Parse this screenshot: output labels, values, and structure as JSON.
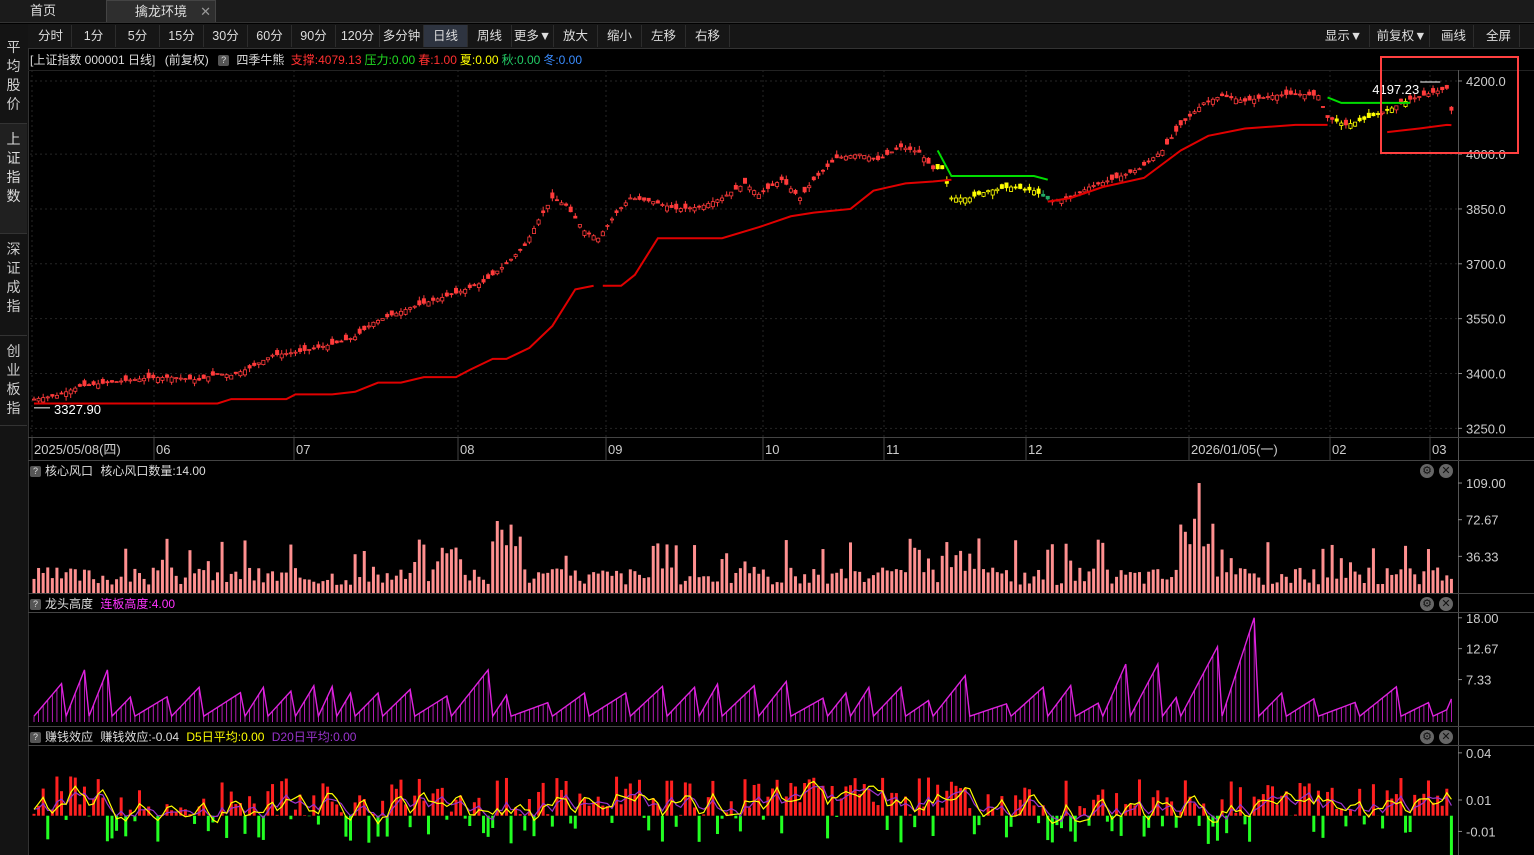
{
  "tabs": {
    "home": "首页",
    "active": "擒龙环境",
    "close": "✕"
  },
  "toolbar": {
    "periods": [
      "分时",
      "1分",
      "5分",
      "15分",
      "30分",
      "60分",
      "90分",
      "120分",
      "多分钟",
      "日线",
      "周线",
      "更多▼",
      "放大",
      "缩小",
      "左移",
      "右移"
    ],
    "active_period": "日线",
    "right": [
      "显示▼",
      "前复权▼",
      "画线",
      "全屏"
    ]
  },
  "sidebar": {
    "items": [
      "平均股价",
      "上证指数",
      "深证成指",
      "创业板指"
    ],
    "active": "上证指数"
  },
  "main": {
    "title": "[上证指数 000001 日线]",
    "adjust": "(前复权)",
    "indicator": "四季牛熊",
    "fields": [
      {
        "label": "支撑:4079.13",
        "color": "#ff3030"
      },
      {
        "label": "压力:0.00",
        "color": "#22dd22"
      },
      {
        "label": "春:1.00",
        "color": "#ff3030"
      },
      {
        "label": "夏:0.00",
        "color": "#ffff00"
      },
      {
        "label": "秋:0.00",
        "color": "#22cc66"
      },
      {
        "label": "冬:0.00",
        "color": "#3a8cff"
      }
    ],
    "high_label": "4197.23",
    "low_label": "3327.90"
  },
  "panels": {
    "p1": {
      "title": "核心风口",
      "field": "核心风口数量:14.00",
      "field_color": "#dddddd"
    },
    "p2": {
      "title": "龙头高度",
      "field": "连板高度:4.00",
      "field_color": "#ff33ff"
    },
    "p3": {
      "title": "赚钱效应",
      "field": "赚钱效应:-0.04",
      "field_color": "#dddddd",
      "d5": "D5日平均:0.00",
      "d5_color": "#ffff00",
      "d20": "D20日平均:0.00",
      "d20_color": "#9933cc"
    }
  },
  "colors": {
    "up": "#ff3b3b",
    "down": "#22c7c7",
    "support": "#e00000",
    "pressure": "#00dd00",
    "summer": "#ffff00",
    "autumn": "#22aa66",
    "bar": "#ff9090",
    "magenta": "#dd22dd",
    "highlight_box": "#ff4040"
  },
  "chart_data": [
    {
      "type": "candlestick",
      "title": "上证指数 000001 日线",
      "y_ticks": [
        4200.0,
        4000.0,
        3850.0,
        3700.0,
        3550.0,
        3400.0,
        3250.0
      ],
      "ylim": [
        3240,
        4230
      ],
      "x_ticks": [
        "2025/05/08(四)",
        "06",
        "07",
        "08",
        "09",
        "10",
        "11",
        "12",
        "2026/01/05(一)",
        "02",
        "03"
      ],
      "close_path": [
        [
          0,
          3330
        ],
        [
          5,
          3340
        ],
        [
          10,
          3365
        ],
        [
          18,
          3378
        ],
        [
          25,
          3388
        ],
        [
          30,
          3390
        ],
        [
          36,
          3382
        ],
        [
          40,
          3400
        ],
        [
          43,
          3395
        ],
        [
          47,
          3415
        ],
        [
          52,
          3450
        ],
        [
          58,
          3460
        ],
        [
          65,
          3480
        ],
        [
          70,
          3500
        ],
        [
          74,
          3540
        ],
        [
          78,
          3560
        ],
        [
          82,
          3580
        ],
        [
          87,
          3600
        ],
        [
          92,
          3620
        ],
        [
          98,
          3650
        ],
        [
          103,
          3700
        ],
        [
          107,
          3750
        ],
        [
          110,
          3820
        ],
        [
          113,
          3880
        ],
        [
          116,
          3860
        ],
        [
          120,
          3790
        ],
        [
          123,
          3770
        ],
        [
          127,
          3840
        ],
        [
          130,
          3880
        ],
        [
          135,
          3870
        ],
        [
          140,
          3850
        ],
        [
          145,
          3855
        ],
        [
          150,
          3880
        ],
        [
          155,
          3920
        ],
        [
          158,
          3890
        ],
        [
          163,
          3930
        ],
        [
          167,
          3880
        ],
        [
          170,
          3930
        ],
        [
          175,
          3990
        ],
        [
          180,
          4000
        ],
        [
          184,
          3985
        ],
        [
          189,
          4020
        ],
        [
          193,
          4005
        ],
        [
          196,
          3960
        ],
        [
          198,
          3960
        ],
        [
          200,
          3880
        ],
        [
          204,
          3880
        ],
        [
          208,
          3900
        ],
        [
          213,
          3910
        ],
        [
          218,
          3900
        ],
        [
          222,
          3870
        ],
        [
          226,
          3880
        ],
        [
          230,
          3910
        ],
        [
          236,
          3935
        ],
        [
          241,
          3960
        ],
        [
          246,
          4010
        ],
        [
          250,
          4080
        ],
        [
          255,
          4140
        ],
        [
          259,
          4160
        ],
        [
          264,
          4145
        ],
        [
          270,
          4160
        ],
        [
          275,
          4165
        ],
        [
          280,
          4160
        ],
        [
          282,
          4100
        ],
        [
          286,
          4080
        ],
        [
          290,
          4095
        ],
        [
          295,
          4120
        ],
        [
          300,
          4150
        ],
        [
          304,
          4165
        ],
        [
          308,
          4180
        ],
        [
          309,
          4120
        ]
      ],
      "high": 4197.23,
      "low": 3327.9,
      "support_segments": [
        [
          [
            0,
            3318
          ],
          [
            40,
            3318
          ],
          [
            43,
            3330
          ],
          [
            55,
            3330
          ],
          [
            57,
            3343
          ],
          [
            65,
            3343
          ],
          [
            70,
            3350
          ],
          [
            75,
            3375
          ],
          [
            80,
            3375
          ],
          [
            85,
            3390
          ],
          [
            92,
            3390
          ],
          [
            95,
            3410
          ],
          [
            100,
            3440
          ],
          [
            103,
            3440
          ],
          [
            108,
            3470
          ],
          [
            113,
            3530
          ],
          [
            118,
            3630
          ],
          [
            122,
            3640
          ]
        ],
        [
          [
            124,
            3640
          ],
          [
            128,
            3640
          ],
          [
            131,
            3670
          ],
          [
            136,
            3770
          ],
          [
            150,
            3770
          ],
          [
            158,
            3800
          ],
          [
            165,
            3830
          ],
          [
            170,
            3840
          ],
          [
            178,
            3850
          ],
          [
            183,
            3900
          ],
          [
            190,
            3920
          ],
          [
            196,
            3925
          ],
          [
            200,
            3930
          ]
        ],
        [
          [
            221,
            3870
          ],
          [
            226,
            3880
          ],
          [
            233,
            3910
          ],
          [
            242,
            3935
          ],
          [
            250,
            4010
          ],
          [
            256,
            4050
          ],
          [
            264,
            4070
          ],
          [
            275,
            4080
          ],
          [
            282,
            4080
          ]
        ],
        [
          [
            295,
            4060
          ],
          [
            302,
            4070
          ],
          [
            308,
            4080
          ],
          [
            309,
            4079.13
          ]
        ]
      ],
      "pressure_segments": [
        [
          [
            197,
            4010
          ],
          [
            200,
            3940
          ],
          [
            218,
            3940
          ],
          [
            221,
            3930
          ]
        ],
        [
          [
            282,
            4155
          ],
          [
            285,
            4140
          ],
          [
            300,
            4140
          ]
        ]
      ]
    },
    {
      "type": "bar",
      "title": "核心风口",
      "series_name": "核心风口数量",
      "y_ticks": [
        109.0,
        72.67,
        36.33
      ],
      "ylim": [
        0,
        112
      ],
      "last": 14.0
    },
    {
      "type": "line",
      "title": "龙头高度",
      "series_name": "连板高度",
      "y_ticks": [
        18.0,
        12.67,
        7.33
      ],
      "ylim": [
        0,
        19
      ],
      "last": 4.0,
      "peaks": [
        [
          10,
          9
        ],
        [
          27,
          6
        ],
        [
          45,
          6
        ],
        [
          70,
          5
        ],
        [
          95,
          9
        ],
        [
          117,
          5
        ],
        [
          137,
          6
        ],
        [
          160,
          7
        ],
        [
          180,
          6
        ],
        [
          195,
          8
        ],
        [
          215,
          6
        ],
        [
          236,
          10
        ],
        [
          251,
          13
        ],
        [
          258,
          18
        ],
        [
          265,
          5
        ],
        [
          275,
          4
        ],
        [
          309,
          4
        ]
      ]
    },
    {
      "type": "bar",
      "title": "赚钱效应",
      "series_name": "赚钱效应",
      "y_ticks": [
        0.04,
        0.01,
        -0.01
      ],
      "ylim": [
        -0.025,
        0.045
      ],
      "last": -0.04
    }
  ]
}
